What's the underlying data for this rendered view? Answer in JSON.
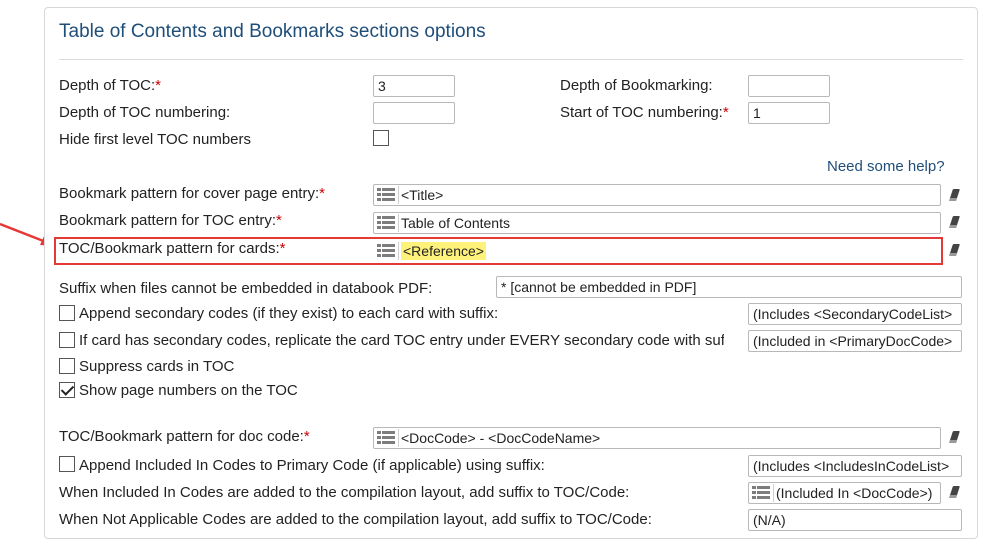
{
  "panel": {
    "title": "Table of Contents and Bookmarks sections options"
  },
  "fields": {
    "depth_toc": {
      "label": "Depth of TOC:",
      "value": "3"
    },
    "depth_toc_numbering": {
      "label": "Depth of TOC numbering:",
      "value": ""
    },
    "hide_first_level": {
      "label": "Hide first level TOC numbers",
      "checked": false
    },
    "depth_bookmarking": {
      "label": "Depth of Bookmarking:",
      "value": ""
    },
    "start_toc_numbering": {
      "label": "Start of TOC numbering:",
      "value": "1"
    },
    "required_mark": "*"
  },
  "help": {
    "label": "Need some help?"
  },
  "patterns": {
    "cover": {
      "label": "Bookmark pattern for cover page entry:",
      "value": "<Title>"
    },
    "toc": {
      "label": "Bookmark pattern for TOC entry:",
      "value": "Table of Contents"
    },
    "cards": {
      "label": "TOC/Bookmark pattern for cards:",
      "value": "<Reference>"
    }
  },
  "options": {
    "suffix_not_embedded": {
      "label": "Suffix when files cannot be embedded in databook PDF:",
      "value": "* [cannot be embedded in PDF]"
    },
    "append_secondary": {
      "label": "Append secondary codes (if they exist) to each card with suffix:",
      "checked": false,
      "value": "(Includes <SecondaryCodeList>"
    },
    "replicate_secondary": {
      "label": "If card has secondary codes, replicate the card TOC entry under EVERY secondary code with suffix",
      "checked": false,
      "value": "(Included in <PrimaryDocCode>"
    },
    "suppress_cards": {
      "label": "Suppress cards in TOC",
      "checked": false
    },
    "show_page_numbers": {
      "label": "Show page numbers on the TOC",
      "checked": true
    }
  },
  "doc_code": {
    "pattern": {
      "label": "TOC/Bookmark pattern for doc code:",
      "value": "<DocCode> - <DocCodeName>"
    },
    "append_included": {
      "label": "Append Included In Codes to Primary Code (if applicable) using suffix:",
      "checked": false,
      "value": "(Includes <IncludesInCodeList>"
    },
    "included_in_suffix": {
      "label": "When Included In Codes are added to the compilation layout, add suffix to TOC/Code:",
      "value": "(Included In <DocCode>)"
    },
    "not_applicable_suffix": {
      "label": "When Not Applicable Codes are added to the compilation layout, add suffix to TOC/Code:",
      "value": "(N/A)"
    }
  },
  "colors": {
    "accent": "#1f4e79",
    "required": "#cc0000",
    "highlight": "#fff27a",
    "callout": "#e53935"
  }
}
